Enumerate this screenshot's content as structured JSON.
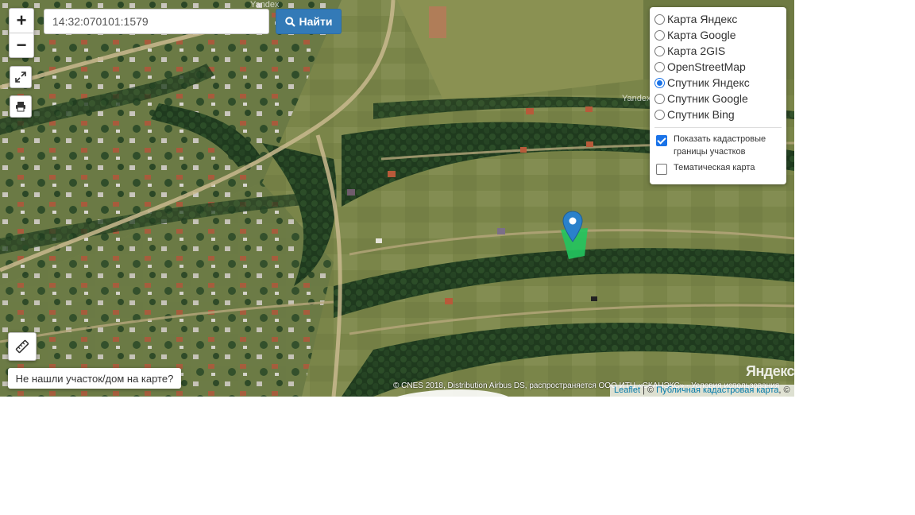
{
  "search": {
    "value": "14:32:070101:1579",
    "button_label": "Найти"
  },
  "zoom": {
    "in_label": "+",
    "out_label": "−"
  },
  "icons": {
    "fullscreen": "fullscreen-icon",
    "print": "print-icon",
    "ruler": "ruler-icon",
    "search": "search-icon",
    "marker": "map-marker-icon"
  },
  "layers": {
    "items": [
      {
        "label": "Карта Яндекс",
        "selected": false
      },
      {
        "label": "Карта Google",
        "selected": false
      },
      {
        "label": "Карта 2GIS",
        "selected": false
      },
      {
        "label": "OpenStreetMap",
        "selected": false
      },
      {
        "label": "Спутник Яндекс",
        "selected": true
      },
      {
        "label": "Спутник Google",
        "selected": false
      },
      {
        "label": "Спутник Bing",
        "selected": false
      }
    ],
    "options": [
      {
        "label": "Показать кадастровые границы участков",
        "checked": true
      },
      {
        "label": "Тематическая карта",
        "checked": false
      }
    ]
  },
  "not_found_label": "Не нашли участок/дом на карте?",
  "copyright": "© CNES 2018, Distribution Airbus DS, распространяется ООО ИТЦ «СКАНЭКС» · Условия использования",
  "attribution": {
    "leaflet": "Leaflet",
    "separator": " | © ",
    "pkk": "Публичная кадастровая карта",
    "tail": ", ©"
  },
  "watermarks": {
    "logo": "Яндекс",
    "small": "Yandex"
  },
  "colors": {
    "accent": "#337ab7",
    "marker": "#2a81cb",
    "parcel": "#22c55e",
    "radio_selected": "#1a73e8"
  }
}
